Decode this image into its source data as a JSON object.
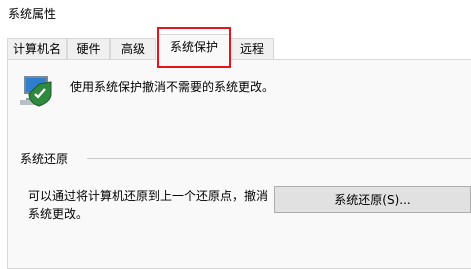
{
  "window": {
    "title": "系统属性"
  },
  "tabs": [
    {
      "label": "计算机名"
    },
    {
      "label": "硬件"
    },
    {
      "label": "高级"
    },
    {
      "label": "系统保护",
      "active": true
    },
    {
      "label": "远程"
    }
  ],
  "highlight_color": "#e8141c",
  "protection": {
    "icon": "computer-protection-icon",
    "description": "使用系统保护撤消不需要的系统更改。"
  },
  "restore": {
    "section_title": "系统还原",
    "text": "可以通过将计算机还原到上一个还原点，撤消系统更改。",
    "button_label": "系统还原(S)..."
  }
}
